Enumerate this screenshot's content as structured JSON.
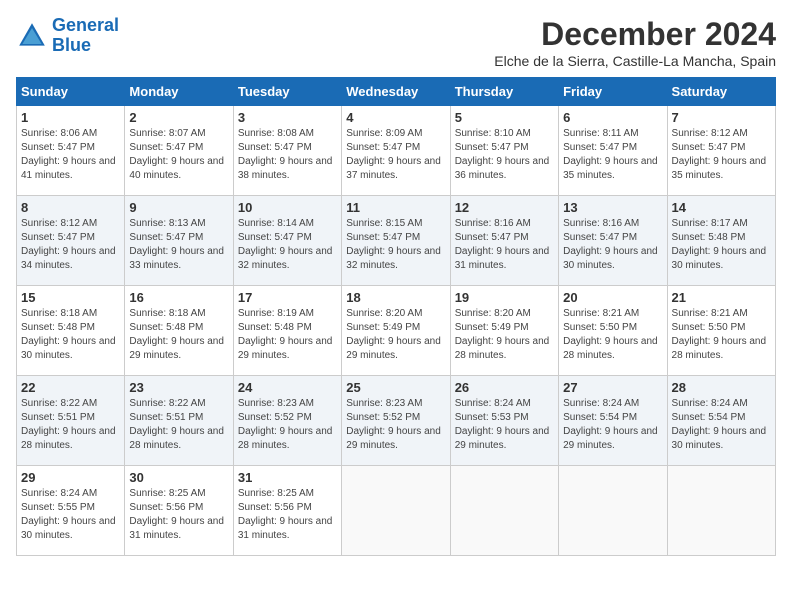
{
  "logo": {
    "line1": "General",
    "line2": "Blue"
  },
  "title": "December 2024",
  "location": "Elche de la Sierra, Castille-La Mancha, Spain",
  "days_of_week": [
    "Sunday",
    "Monday",
    "Tuesday",
    "Wednesday",
    "Thursday",
    "Friday",
    "Saturday"
  ],
  "weeks": [
    [
      {
        "day": "1",
        "sunrise": "8:06 AM",
        "sunset": "5:47 PM",
        "daylight": "9 hours and 41 minutes."
      },
      {
        "day": "2",
        "sunrise": "8:07 AM",
        "sunset": "5:47 PM",
        "daylight": "9 hours and 40 minutes."
      },
      {
        "day": "3",
        "sunrise": "8:08 AM",
        "sunset": "5:47 PM",
        "daylight": "9 hours and 38 minutes."
      },
      {
        "day": "4",
        "sunrise": "8:09 AM",
        "sunset": "5:47 PM",
        "daylight": "9 hours and 37 minutes."
      },
      {
        "day": "5",
        "sunrise": "8:10 AM",
        "sunset": "5:47 PM",
        "daylight": "9 hours and 36 minutes."
      },
      {
        "day": "6",
        "sunrise": "8:11 AM",
        "sunset": "5:47 PM",
        "daylight": "9 hours and 35 minutes."
      },
      {
        "day": "7",
        "sunrise": "8:12 AM",
        "sunset": "5:47 PM",
        "daylight": "9 hours and 35 minutes."
      }
    ],
    [
      {
        "day": "8",
        "sunrise": "8:12 AM",
        "sunset": "5:47 PM",
        "daylight": "9 hours and 34 minutes."
      },
      {
        "day": "9",
        "sunrise": "8:13 AM",
        "sunset": "5:47 PM",
        "daylight": "9 hours and 33 minutes."
      },
      {
        "day": "10",
        "sunrise": "8:14 AM",
        "sunset": "5:47 PM",
        "daylight": "9 hours and 32 minutes."
      },
      {
        "day": "11",
        "sunrise": "8:15 AM",
        "sunset": "5:47 PM",
        "daylight": "9 hours and 32 minutes."
      },
      {
        "day": "12",
        "sunrise": "8:16 AM",
        "sunset": "5:47 PM",
        "daylight": "9 hours and 31 minutes."
      },
      {
        "day": "13",
        "sunrise": "8:16 AM",
        "sunset": "5:47 PM",
        "daylight": "9 hours and 30 minutes."
      },
      {
        "day": "14",
        "sunrise": "8:17 AM",
        "sunset": "5:48 PM",
        "daylight": "9 hours and 30 minutes."
      }
    ],
    [
      {
        "day": "15",
        "sunrise": "8:18 AM",
        "sunset": "5:48 PM",
        "daylight": "9 hours and 30 minutes."
      },
      {
        "day": "16",
        "sunrise": "8:18 AM",
        "sunset": "5:48 PM",
        "daylight": "9 hours and 29 minutes."
      },
      {
        "day": "17",
        "sunrise": "8:19 AM",
        "sunset": "5:48 PM",
        "daylight": "9 hours and 29 minutes."
      },
      {
        "day": "18",
        "sunrise": "8:20 AM",
        "sunset": "5:49 PM",
        "daylight": "9 hours and 29 minutes."
      },
      {
        "day": "19",
        "sunrise": "8:20 AM",
        "sunset": "5:49 PM",
        "daylight": "9 hours and 28 minutes."
      },
      {
        "day": "20",
        "sunrise": "8:21 AM",
        "sunset": "5:50 PM",
        "daylight": "9 hours and 28 minutes."
      },
      {
        "day": "21",
        "sunrise": "8:21 AM",
        "sunset": "5:50 PM",
        "daylight": "9 hours and 28 minutes."
      }
    ],
    [
      {
        "day": "22",
        "sunrise": "8:22 AM",
        "sunset": "5:51 PM",
        "daylight": "9 hours and 28 minutes."
      },
      {
        "day": "23",
        "sunrise": "8:22 AM",
        "sunset": "5:51 PM",
        "daylight": "9 hours and 28 minutes."
      },
      {
        "day": "24",
        "sunrise": "8:23 AM",
        "sunset": "5:52 PM",
        "daylight": "9 hours and 28 minutes."
      },
      {
        "day": "25",
        "sunrise": "8:23 AM",
        "sunset": "5:52 PM",
        "daylight": "9 hours and 29 minutes."
      },
      {
        "day": "26",
        "sunrise": "8:24 AM",
        "sunset": "5:53 PM",
        "daylight": "9 hours and 29 minutes."
      },
      {
        "day": "27",
        "sunrise": "8:24 AM",
        "sunset": "5:54 PM",
        "daylight": "9 hours and 29 minutes."
      },
      {
        "day": "28",
        "sunrise": "8:24 AM",
        "sunset": "5:54 PM",
        "daylight": "9 hours and 30 minutes."
      }
    ],
    [
      {
        "day": "29",
        "sunrise": "8:24 AM",
        "sunset": "5:55 PM",
        "daylight": "9 hours and 30 minutes."
      },
      {
        "day": "30",
        "sunrise": "8:25 AM",
        "sunset": "5:56 PM",
        "daylight": "9 hours and 31 minutes."
      },
      {
        "day": "31",
        "sunrise": "8:25 AM",
        "sunset": "5:56 PM",
        "daylight": "9 hours and 31 minutes."
      },
      null,
      null,
      null,
      null
    ]
  ]
}
